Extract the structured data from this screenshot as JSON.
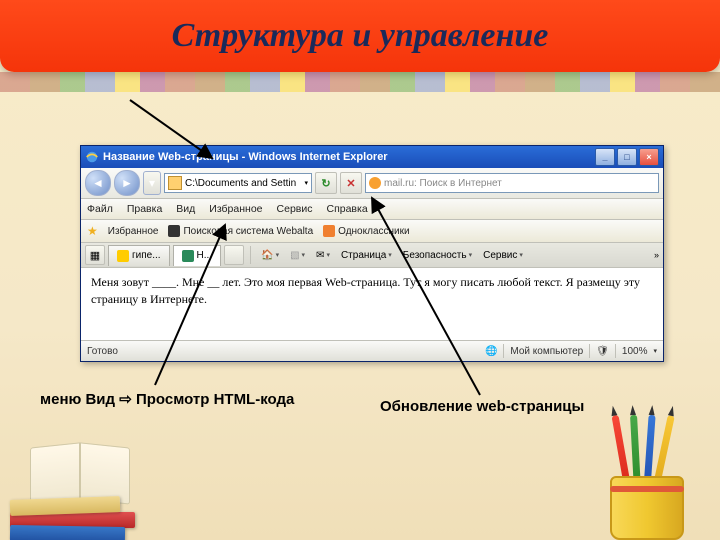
{
  "slide": {
    "title": "Структура и управление"
  },
  "browser": {
    "window_title": "Название Web-страницы - Windows Internet Explorer",
    "url": "C:\\Documents and Settin",
    "search_placeholder": "mail.ru: Поиск в Интернет",
    "menu": [
      "Файл",
      "Правка",
      "Вид",
      "Избранное",
      "Сервис",
      "Справка"
    ],
    "fav_label": "Избранное",
    "fav_items": [
      "Поисковая система Webalta",
      "Одноклассники"
    ],
    "tabs": [
      "гипе...",
      "Н..."
    ],
    "toolbar": [
      "Страница",
      "Безопасность",
      "Сервис"
    ],
    "page_text": "Меня зовут ____. Мне __ лет. Это моя первая Web-страница. Тут я могу писать любой текст. Я размещу эту страницу в Интернете.",
    "status": "Готово",
    "zone": "Мой компьютер",
    "zoom": "100%"
  },
  "annotations": {
    "view_menu": "меню Вид ⇨ Просмотр HTML-кода",
    "refresh": "Обновление web-страницы"
  }
}
